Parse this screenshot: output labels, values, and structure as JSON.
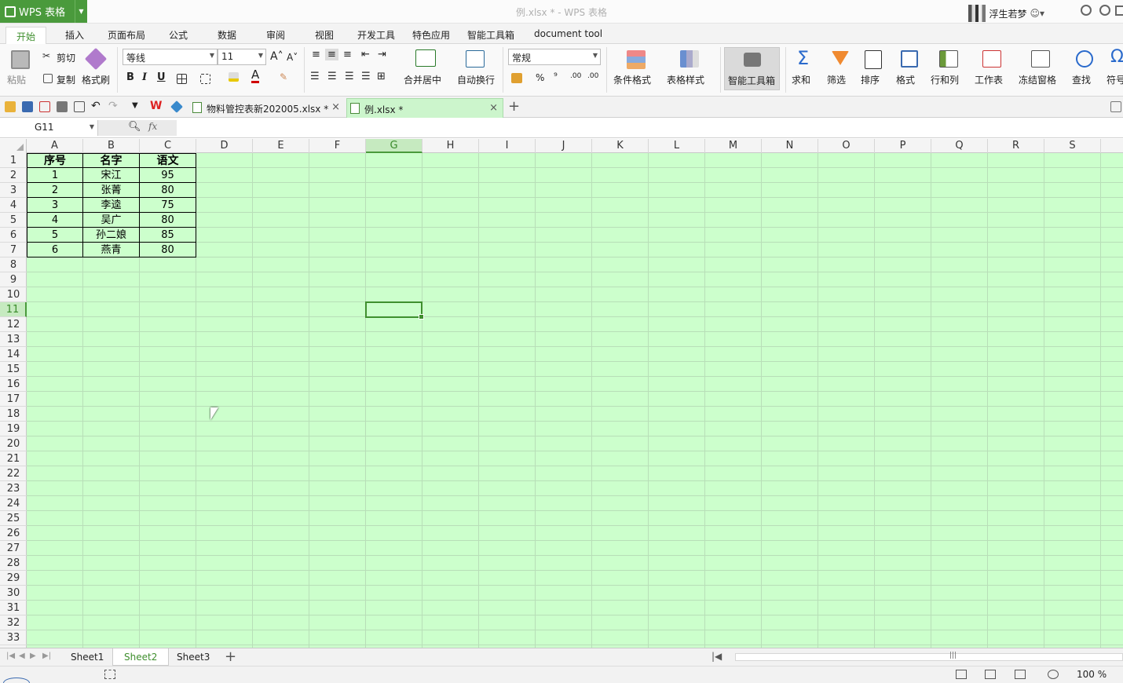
{
  "app": {
    "name": "WPS 表格",
    "window_title": "例.xlsx * - WPS 表格",
    "user_name": "浮生若梦"
  },
  "menu_tabs": [
    "开始",
    "插入",
    "页面布局",
    "公式",
    "数据",
    "审阅",
    "视图",
    "开发工具",
    "特色应用",
    "智能工具箱",
    "document tool"
  ],
  "ribbon": {
    "paste": "粘贴",
    "cut": "剪切",
    "copy": "复制",
    "format_painter": "格式刷",
    "font_name": "等线",
    "font_size": "11",
    "bold": "B",
    "italic": "I",
    "underline": "U",
    "merge_center": "合并居中",
    "wrap_text": "自动换行",
    "number_format": "常规",
    "percent": "%",
    "thousand": "⁹",
    "inc_decimal": ".00",
    "dec_decimal": ".00",
    "conditional_format": "条件格式",
    "table_style": "表格样式",
    "smart_toolbox": "智能工具箱",
    "sum": "求和",
    "filter": "筛选",
    "sort": "排序",
    "format": "格式",
    "rows_cols": "行和列",
    "worksheet": "工作表",
    "freeze_panes": "冻结窗格",
    "find": "查找",
    "symbol": "符号"
  },
  "doc_tabs": [
    {
      "label": "物料管控表新202005.xlsx *",
      "active": false
    },
    {
      "label": "例.xlsx *",
      "active": true
    }
  ],
  "formula_bar": {
    "cell_ref": "G11",
    "fx": "fx",
    "formula": ""
  },
  "columns": [
    "A",
    "B",
    "C",
    "D",
    "E",
    "F",
    "G",
    "H",
    "I",
    "J",
    "K",
    "L",
    "M",
    "N",
    "O",
    "P",
    "Q",
    "R",
    "S"
  ],
  "rows": [
    "1",
    "2",
    "3",
    "4",
    "5",
    "6",
    "7",
    "8",
    "9",
    "10",
    "11",
    "12",
    "13",
    "14",
    "15",
    "16",
    "17",
    "18",
    "19",
    "20",
    "21",
    "22",
    "23",
    "24",
    "25",
    "26",
    "27",
    "28",
    "29",
    "30",
    "31",
    "32",
    "33"
  ],
  "selected_cell": {
    "col": "G",
    "row": "11"
  },
  "table": {
    "headers": [
      "序号",
      "名字",
      "语文"
    ],
    "rows": [
      [
        "1",
        "宋江",
        "95"
      ],
      [
        "2",
        "张菁",
        "80"
      ],
      [
        "3",
        "李逵",
        "75"
      ],
      [
        "4",
        "吴广",
        "80"
      ],
      [
        "5",
        "孙二娘",
        "85"
      ],
      [
        "6",
        "燕青",
        "80"
      ]
    ]
  },
  "sheets": [
    {
      "label": "Sheet1",
      "active": false
    },
    {
      "label": "Sheet2",
      "active": true
    },
    {
      "label": "Sheet3",
      "active": false
    }
  ],
  "add_sheet": "+",
  "status": {
    "zoom": "100 %"
  },
  "colors": {
    "accent": "#4a9a3c",
    "grid_background": "#ccffcc"
  }
}
